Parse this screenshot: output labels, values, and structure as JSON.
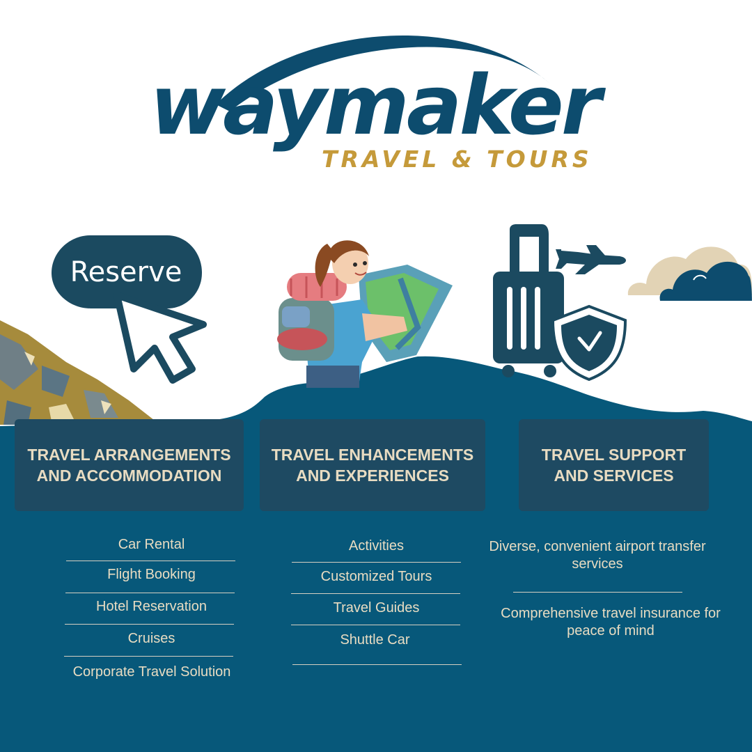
{
  "brand": {
    "name": "waymaker",
    "tagline": "TRAVEL & TOURS",
    "primary_color": "#0d4c6e",
    "accent_color": "#c59a3a"
  },
  "hero": {
    "reserve_label": "Reserve"
  },
  "categories": [
    {
      "title": "TRAVEL ARRANGEMENTS AND ACCOMMODATION",
      "items": [
        "Car Rental",
        "Flight Booking",
        "Hotel Reservation",
        "Cruises",
        "Corporate Travel Solution"
      ]
    },
    {
      "title": "TRAVEL ENHANCEMENTS AND EXPERIENCES",
      "items": [
        "Activities",
        "Customized Tours",
        "Travel Guides",
        "Shuttle Car"
      ]
    },
    {
      "title": "TRAVEL SUPPORT AND SERVICES",
      "items": [
        "Diverse, convenient airport transfer services",
        "Comprehensive travel insurance for peace of mind"
      ]
    }
  ],
  "colors": {
    "ocean": "#07587a",
    "box": "#1e4a62",
    "text": "#e8dcc2",
    "mountain_gold": "#a68b3c",
    "cloud_cream": "#e2d3b5"
  },
  "icons": [
    "cursor-icon",
    "backpacker-illustration",
    "suitcase-icon",
    "airplane-icon",
    "shield-check-icon",
    "cloud-icon",
    "mountain-illustration"
  ]
}
